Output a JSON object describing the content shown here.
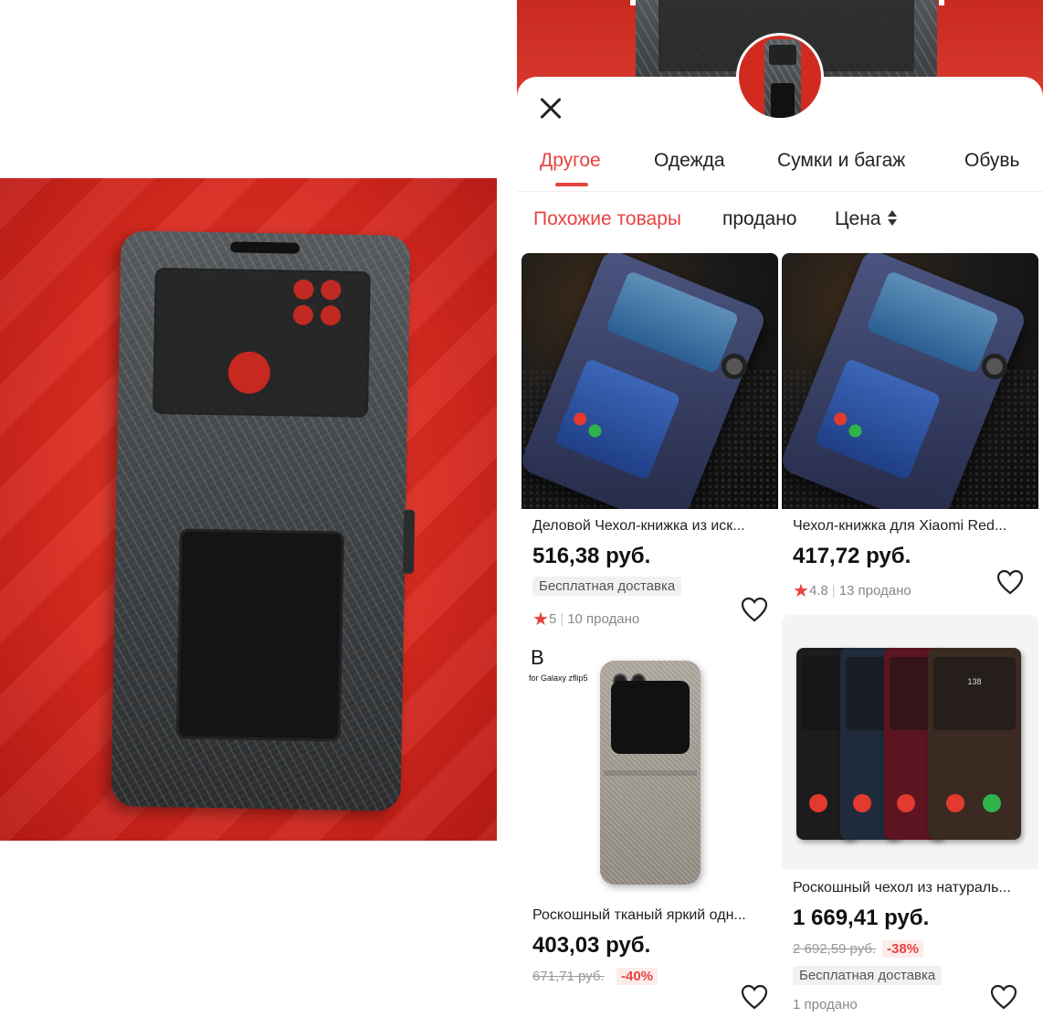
{
  "tabs": [
    {
      "label": "Другое",
      "active": true
    },
    {
      "label": "Одежда",
      "active": false
    },
    {
      "label": "Сумки и багаж",
      "active": false
    },
    {
      "label": "Обувь",
      "active": false
    }
  ],
  "filters": {
    "similar": "Похожие товары",
    "sold": "продано",
    "price": "Цена"
  },
  "products": [
    {
      "title": "Деловой Чехол-книжка из иск...",
      "price": "516,38 руб.",
      "badge": "Бесплатная доставка",
      "rating": "5",
      "sold": "10 продано"
    },
    {
      "title": "Чехол-книжка для Xiaomi Red...",
      "price": "417,72 руб.",
      "rating": "4.8",
      "sold": "13 продано"
    },
    {
      "title": "Роскошный тканый яркий одн...",
      "price": "403,03 руб.",
      "old_price": "671,71 руб.",
      "discount": "-40%",
      "image_text_big": "B",
      "image_text_small": "for Galaxy zflip5"
    },
    {
      "title": "Роскошный чехол из натураль...",
      "price": "1 669,41 руб.",
      "old_price": "2 692,59 руб.",
      "discount": "-38%",
      "badge": "Бесплатная доставка",
      "sold": "1 продано",
      "image_screen_text": "138"
    }
  ],
  "colors": {
    "accent": "#e64340",
    "star": "#e9433d"
  },
  "icons": {
    "close": "close-icon",
    "sort": "sort-icon",
    "favorite": "heart-icon",
    "rating": "star-icon"
  }
}
